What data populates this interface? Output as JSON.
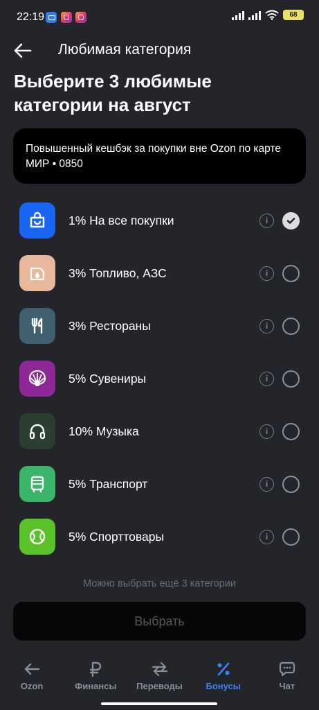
{
  "status_bar": {
    "time": "22:19",
    "battery": "68"
  },
  "header": {
    "title": "Любимая категория"
  },
  "headline": "Выберите 3 любимые категории на август",
  "info_card": {
    "text": "Повышенный кешбэк за покупки вне Ozon по карте МИР • 0850"
  },
  "categories": [
    {
      "label": "1% На все покупки",
      "icon": "shopping-bag-icon",
      "color": "#1a66f2",
      "selected": true
    },
    {
      "label": "3% Топливо, АЗС",
      "icon": "fuel-icon",
      "color": "#e8b89c",
      "selected": false
    },
    {
      "label": "3% Рестораны",
      "icon": "cutlery-icon",
      "color": "#41606f",
      "selected": false
    },
    {
      "label": "5% Сувениры",
      "icon": "shell-icon",
      "color": "#8e2896",
      "selected": false
    },
    {
      "label": "10% Музыка",
      "icon": "headphones-icon",
      "color": "#2b3f30",
      "selected": false
    },
    {
      "label": "5% Транспорт",
      "icon": "bus-icon",
      "color": "#3bb56a",
      "selected": false
    },
    {
      "label": "5% Спорттовары",
      "icon": "ball-icon",
      "color": "#5ac229",
      "selected": false
    }
  ],
  "hint": "Можно выбрать ещё 3 категории",
  "choose_button": "Выбрать",
  "nav": {
    "items": [
      {
        "label": "Ozon",
        "icon": "arrow-left-icon",
        "active": false
      },
      {
        "label": "Финансы",
        "icon": "ruble-icon",
        "active": false
      },
      {
        "label": "Переводы",
        "icon": "transfer-icon",
        "active": false
      },
      {
        "label": "Бонусы",
        "icon": "percent-icon",
        "active": true
      },
      {
        "label": "Чат",
        "icon": "chat-icon",
        "active": false
      }
    ]
  },
  "colors": {
    "background": "#23252b",
    "accent": "#3d7ff5",
    "card": "#000000"
  }
}
